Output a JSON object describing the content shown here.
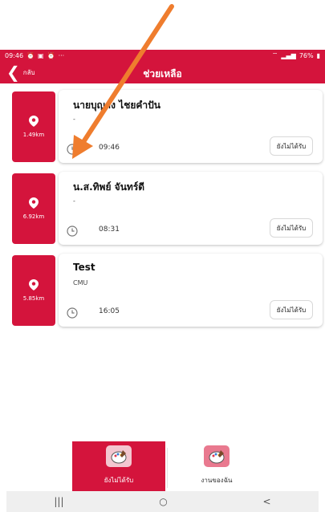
{
  "status_bar": {
    "time": "09:46",
    "left_icons": [
      "alarm-icon",
      "image-icon",
      "alarm-icon"
    ],
    "battery": "76%"
  },
  "header": {
    "back_label": "กลับ",
    "title": "ช่วยเหลือ"
  },
  "requests": [
    {
      "distance": "1.49km",
      "name": "นายบุญส่ง ไชยคำปัน",
      "subtitle": "-",
      "time": "09:46",
      "action_label": "ยังไม่ได้รับ"
    },
    {
      "distance": "6.92km",
      "name": "น.ส.ทิพย์ จันทร์ดี",
      "subtitle": "-",
      "time": "08:31",
      "action_label": "ยังไม่ได้รับ"
    },
    {
      "distance": "5.85km",
      "name": "Test",
      "subtitle": "CMU",
      "time": "16:05",
      "action_label": "ยังไม่ได้รับ"
    }
  ],
  "bottom_nav": [
    {
      "label": "ยังไม่ได้รับ",
      "icon": "palette-icon",
      "active": true
    },
    {
      "label": "งานของฉัน",
      "icon": "palette-icon",
      "active": false
    }
  ],
  "system_nav": {
    "recents": "|||",
    "home": "○",
    "back": "<"
  },
  "colors": {
    "primary": "#d4143c",
    "annotation_arrow": "#ef7d2e"
  }
}
